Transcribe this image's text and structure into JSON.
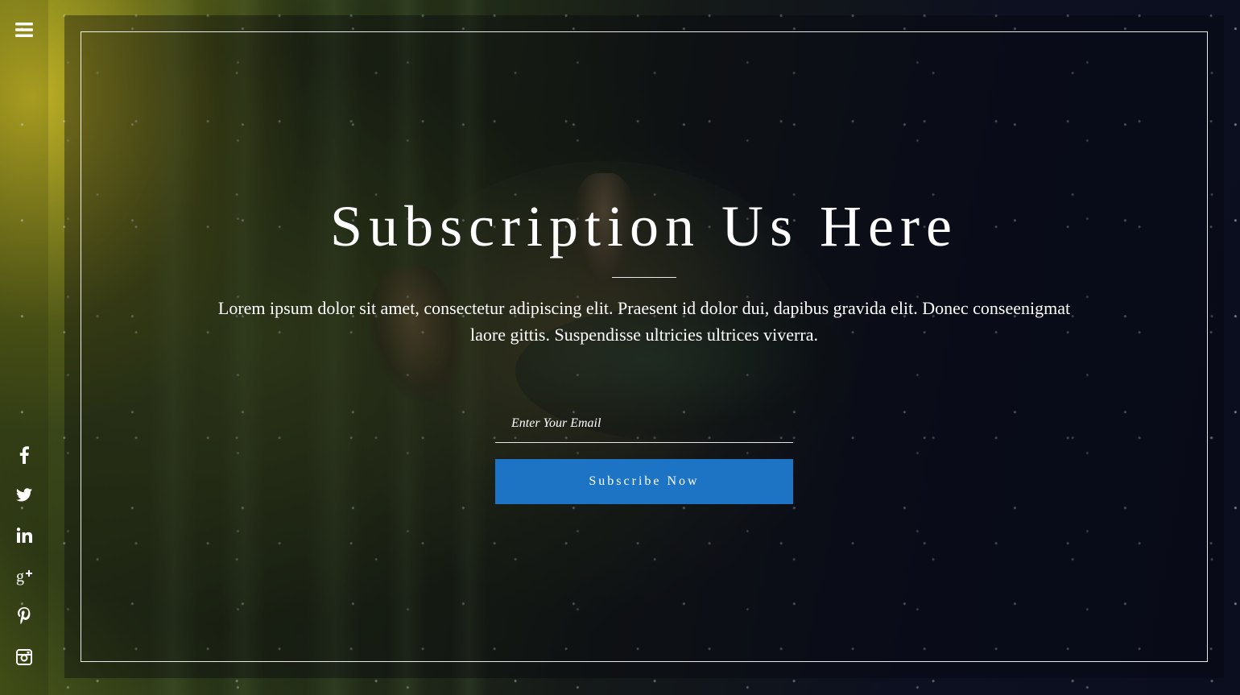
{
  "colors": {
    "accent": "#1e74c4",
    "text": "#ffffff",
    "frame_border": "#ffffff"
  },
  "sidebar": {
    "menu_icon": "hamburger-menu-icon",
    "social_icons": [
      "facebook-icon",
      "twitter-icon",
      "linkedin-icon",
      "google-plus-icon",
      "pinterest-icon",
      "instagram-icon"
    ]
  },
  "hero": {
    "title": "Subscription Us Here",
    "description": "Lorem ipsum dolor sit amet, consectetur adipiscing elit. Praesent id dolor dui, dapibus gravida elit. Donec conseenigmat laore gittis. Suspendisse ultricies ultrices viverra."
  },
  "form": {
    "email_placeholder": "Enter Your Email",
    "email_value": "",
    "submit_label": "Subscribe Now"
  }
}
